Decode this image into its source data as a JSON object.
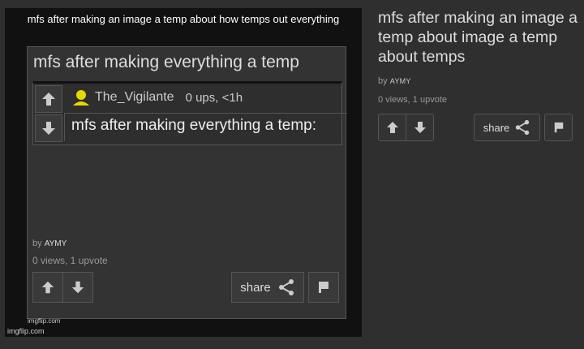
{
  "meme": {
    "caption": "mfs after making an image a temp about how temps out everything",
    "watermark": "imgflip.com",
    "inner": {
      "title": "mfs after making everything a temp",
      "comment": {
        "username": "The_Vigilante",
        "meta": "0 ups, <1h",
        "text": "mfs after making everything a temp:"
      },
      "byline_prefix": "by",
      "author": "AYMY",
      "stats": "0 views, 1 upvote",
      "share_label": "share",
      "watermark": "imgflip.com"
    }
  },
  "post": {
    "title": "mfs after making an image a temp about image a temp about temps",
    "byline_prefix": "by",
    "author": "AYMY",
    "stats": "0 views, 1 upvote",
    "share_label": "share"
  },
  "colors": {
    "background": "#2f2f2f",
    "avatar": "#e8d800",
    "text": "#dddddd"
  },
  "icons": [
    "upvote-icon",
    "downvote-icon",
    "share-icon",
    "flag-icon",
    "user-avatar-icon"
  ]
}
